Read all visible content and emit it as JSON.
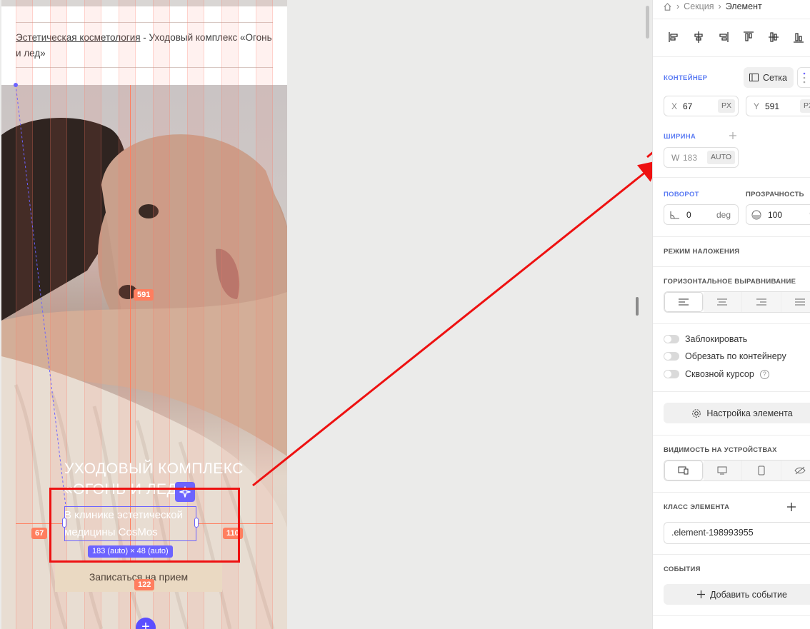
{
  "canvas": {
    "breadcrumb_link": "Эстетическая косметология",
    "breadcrumb_rest": " - Уходовый комплекс «Огонь и лед»",
    "hero_title": "УХОДОВЫЙ КОМПЛЕКС «ОГОНЬ И ЛЕД»",
    "hero_subtitle": "В клинике эстетической медицины CosMos",
    "cta_label": "Записаться на прием",
    "size_badge": "183 (auto) × 48 (auto)",
    "dist_top": "591",
    "dist_left": "67",
    "dist_right": "110",
    "dist_bottom": "122",
    "add_symbol": "+"
  },
  "panel": {
    "breadcrumb": [
      "Секция",
      "Элемент"
    ],
    "container": {
      "label": "КОНТЕЙНЕР",
      "grid_button": "Сетка",
      "x_axis": "X",
      "x_value": "67",
      "x_unit": "PX",
      "y_axis": "Y",
      "y_value": "591",
      "y_unit": "PX"
    },
    "width": {
      "label": "ШИРИНА",
      "axis": "W",
      "value": "183",
      "unit": "AUTO"
    },
    "rotation": {
      "label": "ПОВОРОТ",
      "value": "0",
      "unit": "deg"
    },
    "opacity": {
      "label": "ПРОЗРАЧНОСТЬ",
      "value": "100",
      "unit": "%"
    },
    "blend_mode_label": "РЕЖИМ НАЛОЖЕНИЯ",
    "h_align_label": "ГОРИЗОНТАЛЬНОЕ ВЫРАВНИВАНИЕ",
    "toggles": [
      "Заблокировать",
      "Обрезать по контейнеру",
      "Сквозной курсор"
    ],
    "help_symbol": "?",
    "element_settings": "Настройка элемента",
    "visibility_label": "ВИДИМОСТЬ НА УСТРОЙСТВАХ",
    "class_label": "КЛАСС ЭЛЕМЕНТА",
    "class_value": ".element-198993955",
    "events_label": "СОБЫТИЯ",
    "add_event": "Добавить событие"
  },
  "colors": {
    "selection": "#6c63ff",
    "guide": "#ff7e5f",
    "annotation": "#ee1111",
    "accent_blue": "#5b7bf3",
    "cta_bg": "#ead9c2"
  }
}
